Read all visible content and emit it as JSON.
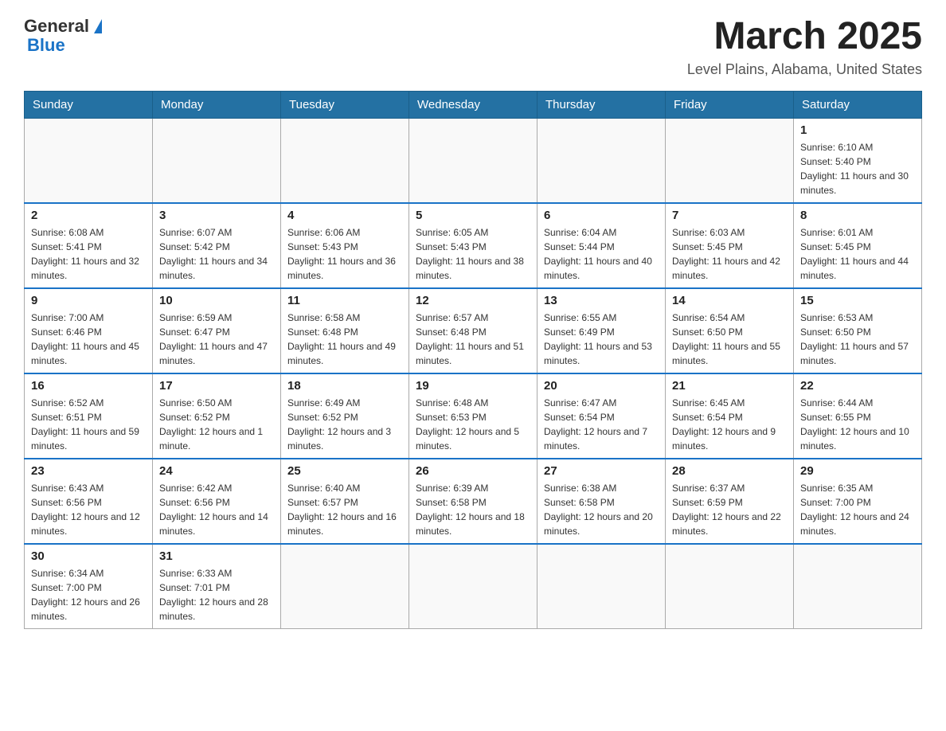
{
  "header": {
    "logo_general": "General",
    "logo_blue": "Blue",
    "month_title": "March 2025",
    "location": "Level Plains, Alabama, United States"
  },
  "days_of_week": [
    "Sunday",
    "Monday",
    "Tuesday",
    "Wednesday",
    "Thursday",
    "Friday",
    "Saturday"
  ],
  "weeks": [
    [
      {
        "day": "",
        "info": ""
      },
      {
        "day": "",
        "info": ""
      },
      {
        "day": "",
        "info": ""
      },
      {
        "day": "",
        "info": ""
      },
      {
        "day": "",
        "info": ""
      },
      {
        "day": "",
        "info": ""
      },
      {
        "day": "1",
        "info": "Sunrise: 6:10 AM\nSunset: 5:40 PM\nDaylight: 11 hours and 30 minutes."
      }
    ],
    [
      {
        "day": "2",
        "info": "Sunrise: 6:08 AM\nSunset: 5:41 PM\nDaylight: 11 hours and 32 minutes."
      },
      {
        "day": "3",
        "info": "Sunrise: 6:07 AM\nSunset: 5:42 PM\nDaylight: 11 hours and 34 minutes."
      },
      {
        "day": "4",
        "info": "Sunrise: 6:06 AM\nSunset: 5:43 PM\nDaylight: 11 hours and 36 minutes."
      },
      {
        "day": "5",
        "info": "Sunrise: 6:05 AM\nSunset: 5:43 PM\nDaylight: 11 hours and 38 minutes."
      },
      {
        "day": "6",
        "info": "Sunrise: 6:04 AM\nSunset: 5:44 PM\nDaylight: 11 hours and 40 minutes."
      },
      {
        "day": "7",
        "info": "Sunrise: 6:03 AM\nSunset: 5:45 PM\nDaylight: 11 hours and 42 minutes."
      },
      {
        "day": "8",
        "info": "Sunrise: 6:01 AM\nSunset: 5:45 PM\nDaylight: 11 hours and 44 minutes."
      }
    ],
    [
      {
        "day": "9",
        "info": "Sunrise: 7:00 AM\nSunset: 6:46 PM\nDaylight: 11 hours and 45 minutes."
      },
      {
        "day": "10",
        "info": "Sunrise: 6:59 AM\nSunset: 6:47 PM\nDaylight: 11 hours and 47 minutes."
      },
      {
        "day": "11",
        "info": "Sunrise: 6:58 AM\nSunset: 6:48 PM\nDaylight: 11 hours and 49 minutes."
      },
      {
        "day": "12",
        "info": "Sunrise: 6:57 AM\nSunset: 6:48 PM\nDaylight: 11 hours and 51 minutes."
      },
      {
        "day": "13",
        "info": "Sunrise: 6:55 AM\nSunset: 6:49 PM\nDaylight: 11 hours and 53 minutes."
      },
      {
        "day": "14",
        "info": "Sunrise: 6:54 AM\nSunset: 6:50 PM\nDaylight: 11 hours and 55 minutes."
      },
      {
        "day": "15",
        "info": "Sunrise: 6:53 AM\nSunset: 6:50 PM\nDaylight: 11 hours and 57 minutes."
      }
    ],
    [
      {
        "day": "16",
        "info": "Sunrise: 6:52 AM\nSunset: 6:51 PM\nDaylight: 11 hours and 59 minutes."
      },
      {
        "day": "17",
        "info": "Sunrise: 6:50 AM\nSunset: 6:52 PM\nDaylight: 12 hours and 1 minute."
      },
      {
        "day": "18",
        "info": "Sunrise: 6:49 AM\nSunset: 6:52 PM\nDaylight: 12 hours and 3 minutes."
      },
      {
        "day": "19",
        "info": "Sunrise: 6:48 AM\nSunset: 6:53 PM\nDaylight: 12 hours and 5 minutes."
      },
      {
        "day": "20",
        "info": "Sunrise: 6:47 AM\nSunset: 6:54 PM\nDaylight: 12 hours and 7 minutes."
      },
      {
        "day": "21",
        "info": "Sunrise: 6:45 AM\nSunset: 6:54 PM\nDaylight: 12 hours and 9 minutes."
      },
      {
        "day": "22",
        "info": "Sunrise: 6:44 AM\nSunset: 6:55 PM\nDaylight: 12 hours and 10 minutes."
      }
    ],
    [
      {
        "day": "23",
        "info": "Sunrise: 6:43 AM\nSunset: 6:56 PM\nDaylight: 12 hours and 12 minutes."
      },
      {
        "day": "24",
        "info": "Sunrise: 6:42 AM\nSunset: 6:56 PM\nDaylight: 12 hours and 14 minutes."
      },
      {
        "day": "25",
        "info": "Sunrise: 6:40 AM\nSunset: 6:57 PM\nDaylight: 12 hours and 16 minutes."
      },
      {
        "day": "26",
        "info": "Sunrise: 6:39 AM\nSunset: 6:58 PM\nDaylight: 12 hours and 18 minutes."
      },
      {
        "day": "27",
        "info": "Sunrise: 6:38 AM\nSunset: 6:58 PM\nDaylight: 12 hours and 20 minutes."
      },
      {
        "day": "28",
        "info": "Sunrise: 6:37 AM\nSunset: 6:59 PM\nDaylight: 12 hours and 22 minutes."
      },
      {
        "day": "29",
        "info": "Sunrise: 6:35 AM\nSunset: 7:00 PM\nDaylight: 12 hours and 24 minutes."
      }
    ],
    [
      {
        "day": "30",
        "info": "Sunrise: 6:34 AM\nSunset: 7:00 PM\nDaylight: 12 hours and 26 minutes."
      },
      {
        "day": "31",
        "info": "Sunrise: 6:33 AM\nSunset: 7:01 PM\nDaylight: 12 hours and 28 minutes."
      },
      {
        "day": "",
        "info": ""
      },
      {
        "day": "",
        "info": ""
      },
      {
        "day": "",
        "info": ""
      },
      {
        "day": "",
        "info": ""
      },
      {
        "day": "",
        "info": ""
      }
    ]
  ]
}
